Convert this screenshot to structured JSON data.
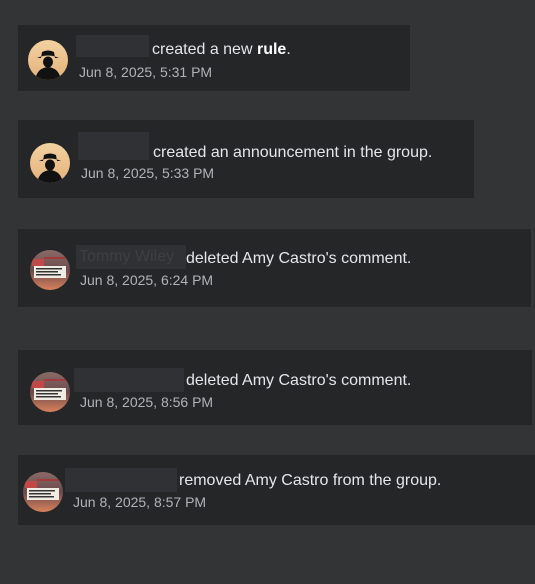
{
  "activity": [
    {
      "avatar": "cowboy-silhouette-avatar",
      "actor": "",
      "action_text": "created a new",
      "action_emphasis": "rule",
      "action_suffix": ".",
      "timestamp": "Jun 8, 2025, 5:31 PM"
    },
    {
      "avatar": "cowboy-silhouette-avatar",
      "actor": "",
      "action_text": "created an announcement in the group.",
      "timestamp": "Jun 8, 2025, 5:33 PM"
    },
    {
      "avatar": "flag-sign-avatar",
      "actor": "Tommy Wiley",
      "action_text": "deleted Amy Castro's comment.",
      "timestamp": "Jun 8, 2025, 6:24 PM"
    },
    {
      "avatar": "flag-sign-avatar",
      "actor": "",
      "action_text": "deleted Amy Castro's comment.",
      "timestamp": "Jun 8, 2025, 8:56 PM"
    },
    {
      "avatar": "flag-sign-avatar",
      "actor": "",
      "action_text": "removed Amy Castro from the group.",
      "timestamp": "Jun 8, 2025, 8:57 PM"
    }
  ],
  "colors": {
    "page_background": "#333436",
    "card_background": "#252628",
    "primary_text": "#e4e6eb",
    "secondary_text": "#b0b3b8"
  }
}
